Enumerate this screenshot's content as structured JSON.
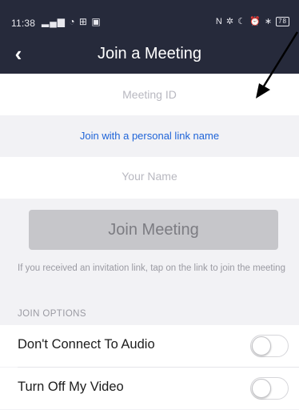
{
  "status_bar": {
    "time": "11:38",
    "left_icons": [
      "signal-icon",
      "wifi-icon",
      "network-icon",
      "gallery-notification-icon"
    ],
    "right_icons": [
      "nfc-icon",
      "silent-icon",
      "moon-icon",
      "alarm-icon",
      "bluetooth-icon"
    ],
    "battery_level": "78"
  },
  "header": {
    "back_icon": "chevron-left-icon",
    "title": "Join a Meeting"
  },
  "form": {
    "meeting_id_placeholder": "Meeting ID",
    "personal_link_label": "Join with a personal link name",
    "name_placeholder": "Your Name",
    "join_button_label": "Join Meeting",
    "hint": "If you received an invitation link, tap on the link to join the meeting"
  },
  "join_options": {
    "header": "JOIN OPTIONS",
    "items": [
      {
        "label": "Don't Connect To Audio",
        "on": false
      },
      {
        "label": "Turn Off My Video",
        "on": false
      }
    ]
  },
  "annotation": {
    "icon": "annotation-arrow-icon",
    "color": "#000000"
  },
  "colors": {
    "header_bg": "#262a3b",
    "link": "#1f64d8",
    "disabled_button": "#c6c6ca",
    "background": "#f2f2f5"
  }
}
